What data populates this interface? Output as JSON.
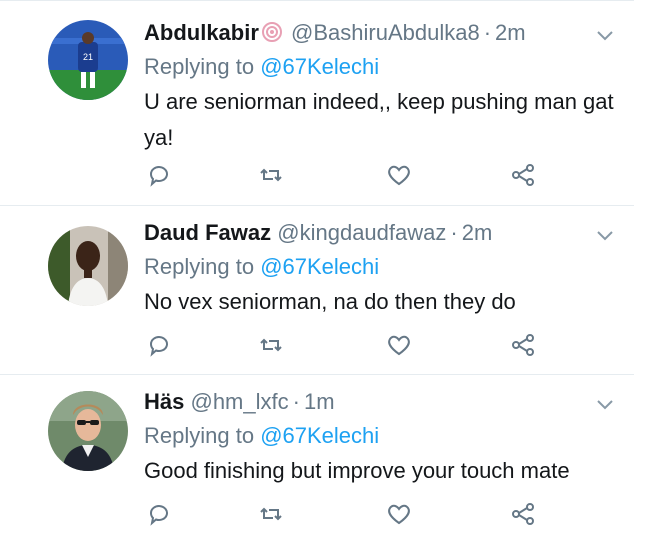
{
  "tweets": [
    {
      "name": "Abdulkabir",
      "handle": "@BashiruAbdulka8",
      "separator": "·",
      "time": "2m",
      "replying_prefix": "Replying to",
      "replying_to": "@67Kelechi",
      "text": "U are seniorman indeed,, keep pushing man gat ya!",
      "has_badge": true
    },
    {
      "name": "Daud Fawaz",
      "handle": "@kingdaudfawaz",
      "separator": "·",
      "time": "2m",
      "replying_prefix": "Replying to",
      "replying_to": "@67Kelechi",
      "text": "No vex seniorman, na do then they do"
    },
    {
      "name": "Häs",
      "handle": "@hm_lxfc",
      "separator": "·",
      "time": "1m",
      "replying_prefix": "Replying to",
      "replying_to": "@67Kelechi",
      "text": "Good finishing but improve your touch mate"
    }
  ],
  "icons": {
    "reply": "reply-icon",
    "retweet": "retweet-icon",
    "like": "heart-icon",
    "share": "share-icon",
    "menu": "chevron-down-icon"
  },
  "colors": {
    "name": "#14171a",
    "meta": "#657786",
    "mention": "#1da1f2",
    "divider": "#e6ecf0"
  }
}
